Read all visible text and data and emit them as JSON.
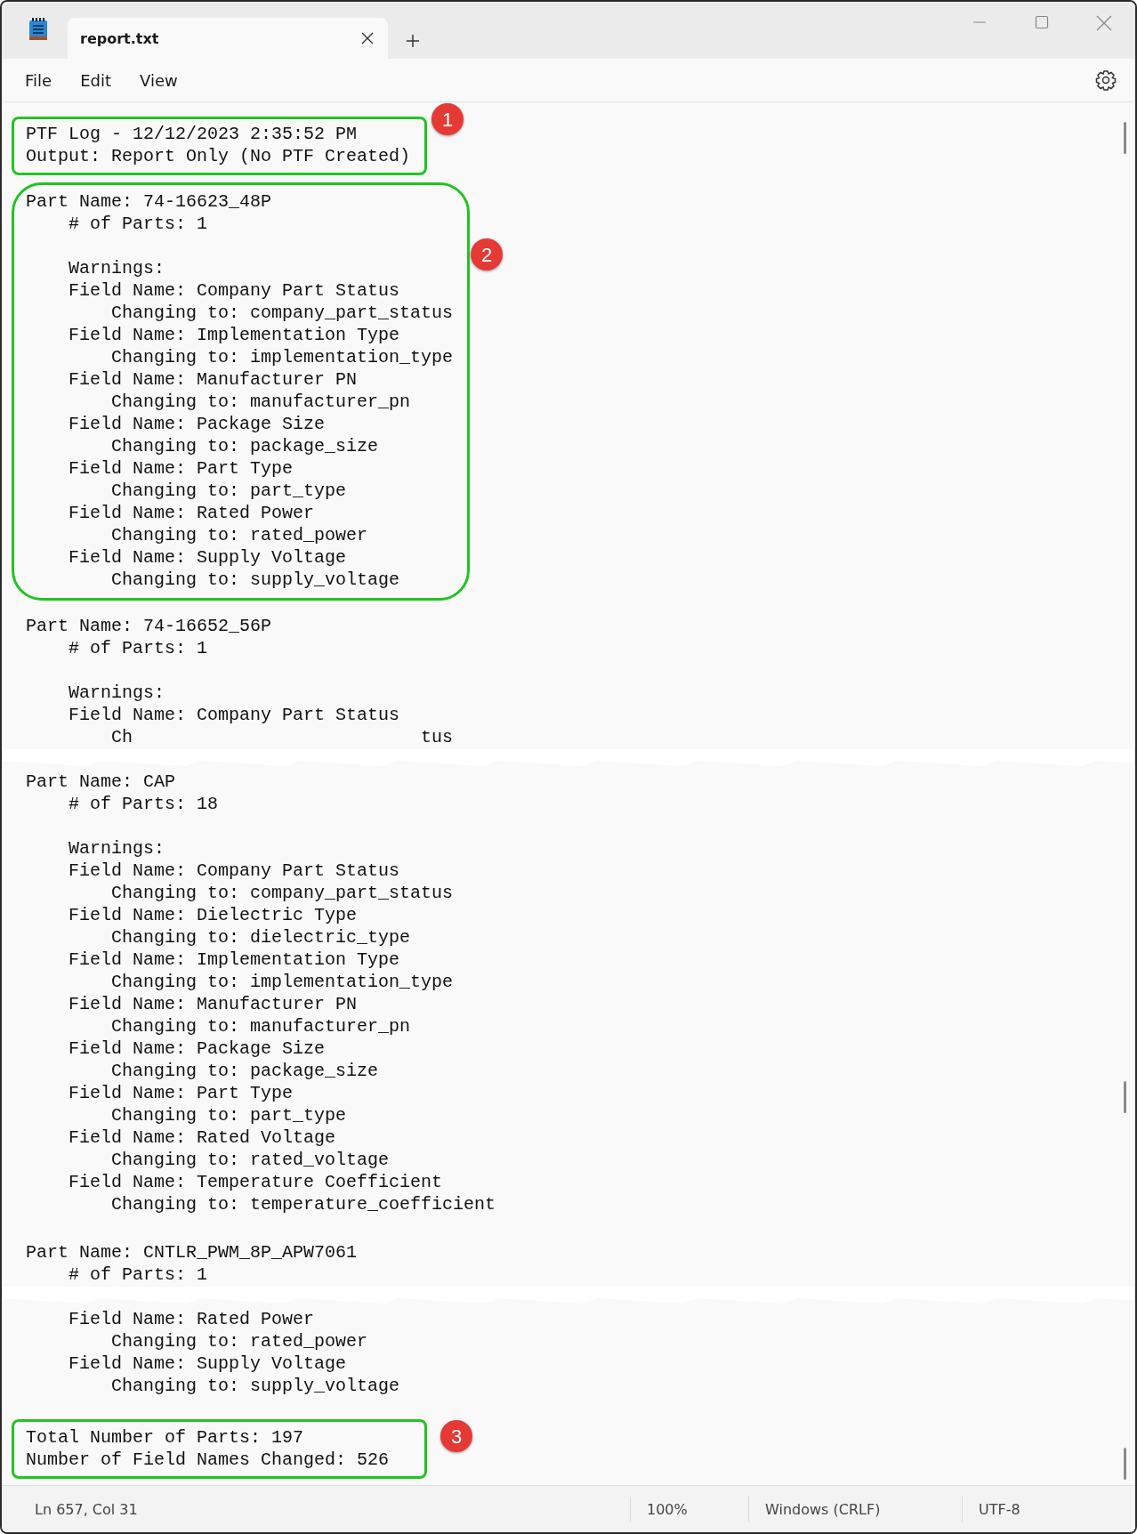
{
  "window": {
    "tabs": [
      {
        "title": "report.txt",
        "selected": true
      }
    ],
    "menu": [
      "File",
      "Edit",
      "View"
    ]
  },
  "document": {
    "blocks": [
      {
        "kind": "header",
        "marker": "1",
        "lines": [
          "PTF Log - 12/12/2023 2:35:52 PM",
          "Output: Report Only (No PTF Created)"
        ]
      },
      {
        "kind": "part",
        "marker": "2",
        "name": "Part Name: 74-16623_48P",
        "count": "# of Parts: 1",
        "warnings": "Warnings:",
        "fields": [
          {
            "field": "Field Name: Company Part Status",
            "change": "Changing to: company_part_status"
          },
          {
            "field": "Field Name: Implementation Type",
            "change": "Changing to: implementation_type"
          },
          {
            "field": "Field Name: Manufacturer PN",
            "change": "Changing to: manufacturer_pn"
          },
          {
            "field": "Field Name: Package Size",
            "change": "Changing to: package_size"
          },
          {
            "field": "Field Name: Part Type",
            "change": "Changing to: part_type"
          },
          {
            "field": "Field Name: Rated Power",
            "change": "Changing to: rated_power"
          },
          {
            "field": "Field Name: Supply Voltage",
            "change": "Changing to: supply_voltage"
          }
        ]
      },
      {
        "kind": "part",
        "name": "Part Name: 74-16652_56P",
        "count": "# of Parts: 1",
        "warnings": "Warnings:",
        "fields": [
          {
            "field": "Field Name: Company Part Status",
            "change_fragments": [
              "Ch",
              "tus"
            ]
          }
        ]
      },
      {
        "kind": "tear"
      },
      {
        "kind": "part",
        "name": "Part Name: CAP",
        "count": "# of Parts: 18",
        "warnings": "Warnings:",
        "fields": [
          {
            "field": "Field Name: Company Part Status",
            "change": "Changing to: company_part_status"
          },
          {
            "field": "Field Name: Dielectric Type",
            "change": "Changing to: dielectric_type"
          },
          {
            "field": "Field Name: Implementation Type",
            "change": "Changing to: implementation_type"
          },
          {
            "field": "Field Name: Manufacturer PN",
            "change": "Changing to: manufacturer_pn"
          },
          {
            "field": "Field Name: Package Size",
            "change": "Changing to: package_size"
          },
          {
            "field": "Field Name: Part Type",
            "change": "Changing to: part_type"
          },
          {
            "field": "Field Name: Rated Voltage",
            "change": "Changing to: rated_voltage"
          },
          {
            "field": "Field Name: Temperature Coefficient",
            "change": "Changing to: temperature_coefficient"
          }
        ]
      },
      {
        "kind": "part",
        "name": "Part Name: CNTLR_PWM_8P_APW7061",
        "count": "# of Parts: 1"
      },
      {
        "kind": "tear"
      },
      {
        "kind": "fields",
        "fields": [
          {
            "field": "Field Name: Rated Power",
            "change": "Changing to: rated_power"
          },
          {
            "field": "Field Name: Supply Voltage",
            "change": "Changing to: supply_voltage"
          }
        ]
      },
      {
        "kind": "totals",
        "marker": "3",
        "lines": [
          "Total Number of Parts: 197",
          "Number of Field Names Changed: 526"
        ]
      }
    ]
  },
  "status_bar": {
    "position": "Ln 657, Col 31",
    "zoom": "100%",
    "line_ending": "Windows (CRLF)",
    "encoding": "UTF-8"
  }
}
